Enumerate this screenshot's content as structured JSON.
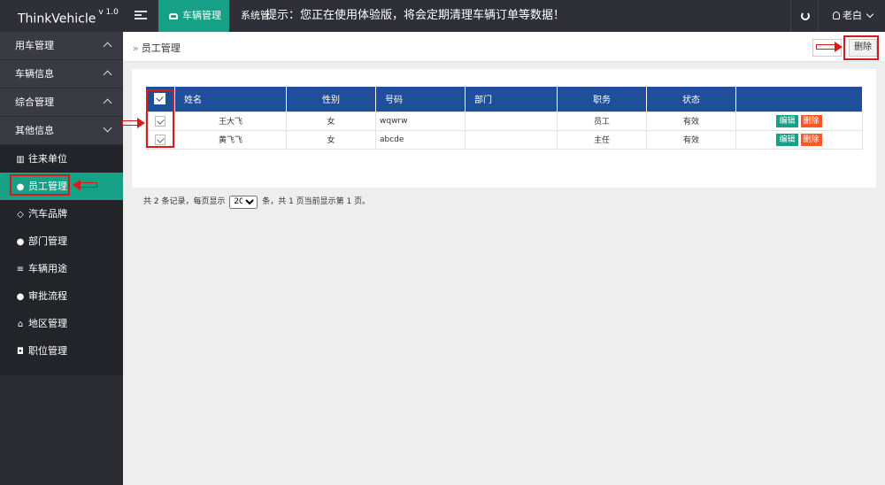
{
  "header": {
    "brand": "ThinkVehicle",
    "version": "v 1.0",
    "active_tab": "车辆管理",
    "tab": "系统管",
    "notice": "提示：您正在使用体验版，将会定期清理车辆订单等数据！",
    "user": "老白"
  },
  "sidebar": {
    "groups": [
      {
        "label": "用车管理"
      },
      {
        "label": "车辆信息"
      },
      {
        "label": "综合管理"
      },
      {
        "label": "其他信息"
      }
    ],
    "items": [
      {
        "label": "往来单位",
        "icon": "bank-icon"
      },
      {
        "label": "员工管理",
        "icon": "user-icon"
      },
      {
        "label": "汽车品牌",
        "icon": "diamond-icon"
      },
      {
        "label": "部门管理",
        "icon": "users-icon"
      },
      {
        "label": "车辆用途",
        "icon": "list-icon"
      },
      {
        "label": "审批流程",
        "icon": "android-icon"
      },
      {
        "label": "地区管理",
        "icon": "home-icon"
      },
      {
        "label": "职位管理",
        "icon": "camera-icon"
      }
    ]
  },
  "main": {
    "breadcrumb": "员工管理",
    "delete_label": "删除",
    "table": {
      "columns": [
        "姓名",
        "性别",
        "号码",
        "部门",
        "职务",
        "状态"
      ],
      "rows": [
        {
          "name": "王大飞",
          "gender": "女",
          "number": "wqwrw",
          "dept": "",
          "position": "员工",
          "status": "有效",
          "edit": "编辑",
          "del": "删除"
        },
        {
          "name": "黄飞飞",
          "gender": "女",
          "number": "abcde",
          "dept": "",
          "position": "主任",
          "status": "有效",
          "edit": "编辑",
          "del": "删除"
        }
      ]
    },
    "pager": {
      "prefix": "共 2 条记录，每页显示",
      "page_size": "20",
      "suffix": "条，共 1 页当前显示第 1 页。"
    }
  },
  "colors": {
    "topbar": "#2f3037",
    "accent": "#16a085",
    "table_header": "#1f4f9b",
    "danger": "#ff5722",
    "annotation": "#d9191c"
  }
}
